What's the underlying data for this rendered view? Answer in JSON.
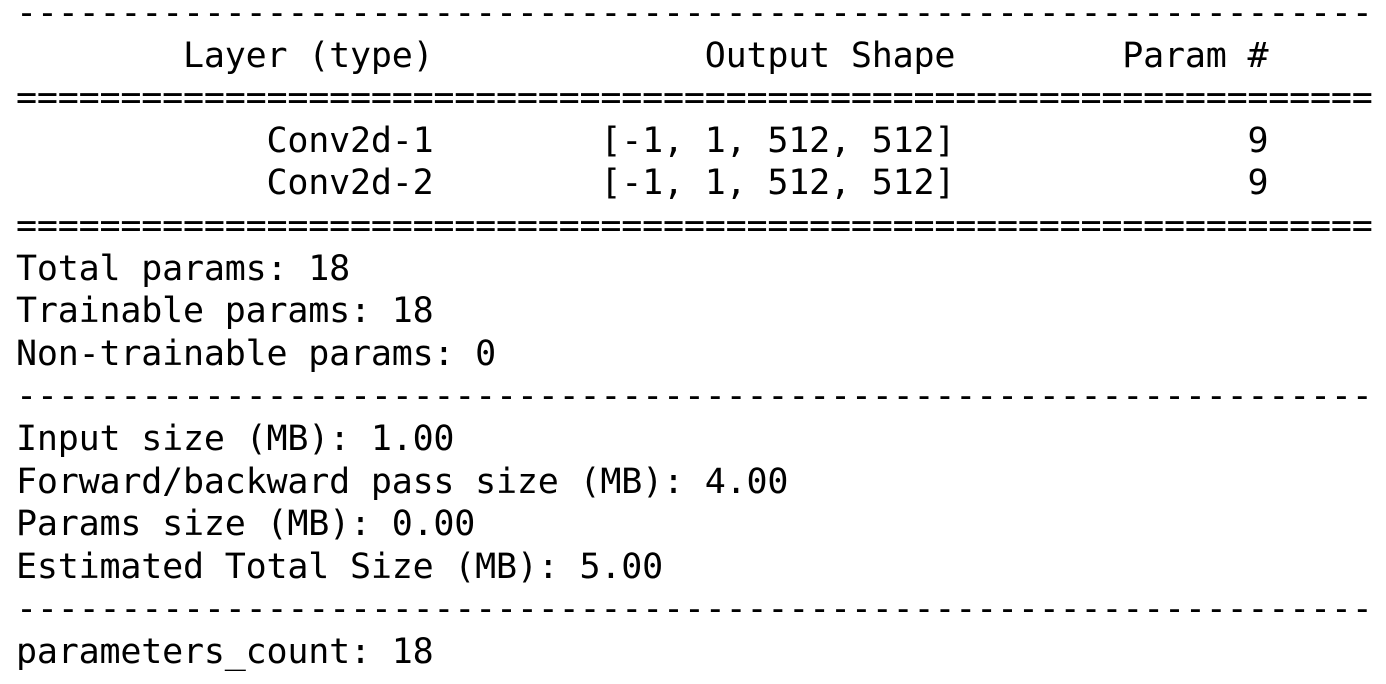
{
  "rules": {
    "dash": "-----------------------------------------------------------------",
    "equals": "================================================================="
  },
  "header": {
    "layer_type": "Layer (type)",
    "output_shape": "Output Shape",
    "param_count": "Param #"
  },
  "layers": [
    {
      "name": "Conv2d-1",
      "output_shape": "[-1, 1, 512, 512]",
      "params": "9"
    },
    {
      "name": "Conv2d-2",
      "output_shape": "[-1, 1, 512, 512]",
      "params": "9"
    }
  ],
  "summary": {
    "total_params": "Total params: 18",
    "trainable_params": "Trainable params: 18",
    "non_trainable_params": "Non-trainable params: 0"
  },
  "sizes": {
    "input_size": "Input size (MB): 1.00",
    "forward_backward_size": "Forward/backward pass size (MB): 4.00",
    "params_size": "Params size (MB): 0.00",
    "estimated_total_size": "Estimated Total Size (MB): 5.00"
  },
  "footer": {
    "parameters_count": "parameters_count: 18"
  }
}
